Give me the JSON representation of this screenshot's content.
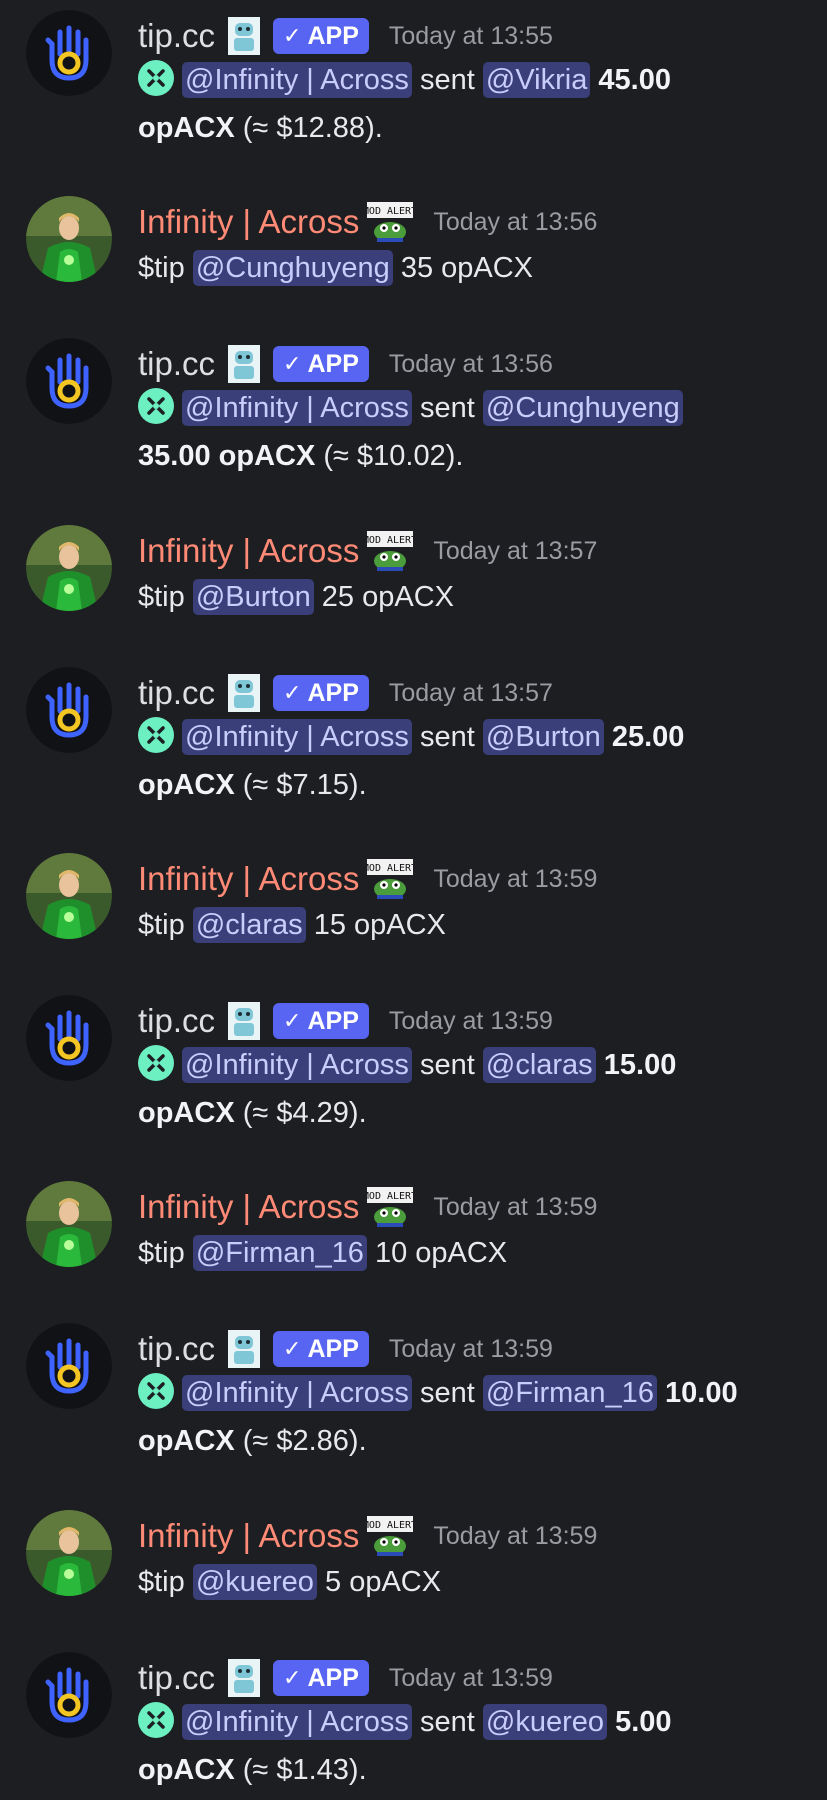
{
  "messages": [
    {
      "author": "tip.cc",
      "badge": "APP",
      "time": "Today at 13:55",
      "from": "@Infinity | Across",
      "verb": "sent",
      "to": "@Vikria",
      "amount": "45.00",
      "token": "opACX",
      "usd": "(≈ $12.88)."
    },
    {
      "author": "Infinity | Across",
      "time": "Today at 13:56",
      "cmd": "$tip",
      "to": "@Cunghuyeng",
      "text": "35 opACX"
    },
    {
      "author": "tip.cc",
      "badge": "APP",
      "time": "Today at 13:56",
      "from": "@Infinity | Across",
      "verb": "sent",
      "to": "@Cunghuyeng",
      "amount": "35.00",
      "token": "opACX",
      "usd": "(≈ $10.02)."
    },
    {
      "author": "Infinity | Across",
      "time": "Today at 13:57",
      "cmd": "$tip",
      "to": "@Burton",
      "text": "25 opACX"
    },
    {
      "author": "tip.cc",
      "badge": "APP",
      "time": "Today at 13:57",
      "from": "@Infinity | Across",
      "verb": "sent",
      "to": "@Burton",
      "amount": "25.00",
      "token": "opACX",
      "usd": "(≈ $7.15)."
    },
    {
      "author": "Infinity | Across",
      "time": "Today at 13:59",
      "cmd": "$tip",
      "to": "@claras",
      "text": "15 opACX"
    },
    {
      "author": "tip.cc",
      "badge": "APP",
      "time": "Today at 13:59",
      "from": "@Infinity | Across",
      "verb": "sent",
      "to": "@claras",
      "amount": "15.00",
      "token": "opACX",
      "usd": "(≈ $4.29)."
    },
    {
      "author": "Infinity | Across",
      "time": "Today at 13:59",
      "cmd": "$tip",
      "to": "@Firman_16",
      "text": "10 opACX"
    },
    {
      "author": "tip.cc",
      "badge": "APP",
      "time": "Today at 13:59",
      "from": "@Infinity | Across",
      "verb": "sent",
      "to": "@Firman_16",
      "amount": "10.00",
      "token": "opACX",
      "usd": "(≈ $2.86)."
    },
    {
      "author": "Infinity | Across",
      "time": "Today at 13:59",
      "cmd": "$tip",
      "to": "@kuereo",
      "text": "5 opACX"
    },
    {
      "author": "tip.cc",
      "badge": "APP",
      "time": "Today at 13:59",
      "from": "@Infinity | Across",
      "verb": "sent",
      "to": "@kuereo",
      "amount": "5.00",
      "token": "opACX",
      "usd": "(≈ $1.43)."
    }
  ],
  "badge_check": "✓",
  "mod_badge_text": "MOD ALERT",
  "colors": {
    "bot_name": "#dcdee1",
    "user_name": "#ff8a75",
    "app_badge": "#5865f2",
    "mention_bg": "#3a3f7a",
    "across_icon": "#6cf0c2"
  }
}
